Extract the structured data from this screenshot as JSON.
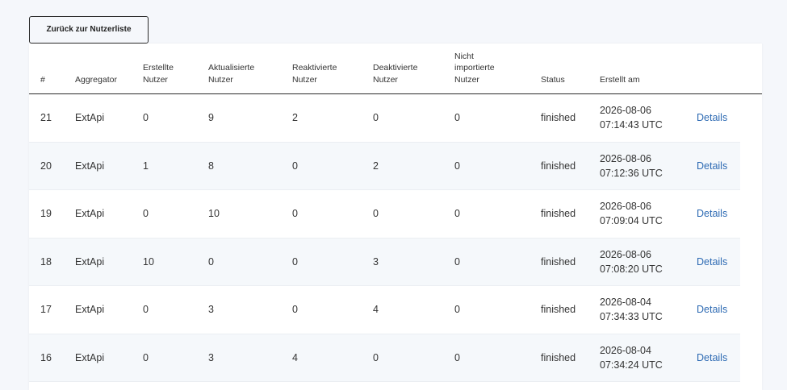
{
  "back_button": {
    "label": "Zurück zur Nutzerliste"
  },
  "table": {
    "headers": [
      "#",
      "Aggregator",
      "Erstellte\nNutzer",
      "Aktualisierte\nNutzer",
      "Reaktivierte\nNutzer",
      "Deaktivierte\nNutzer",
      "Nicht\nimportierte\nNutzer",
      "Status",
      "Erstellt am"
    ],
    "rows": [
      {
        "id": "21",
        "aggregator": "ExtApi",
        "created": "0",
        "updated": "9",
        "reactivated": "2",
        "deactivated": "0",
        "not_imported": "0",
        "status": "finished",
        "created_at": "2026-08-06 07:14:43 UTC",
        "action": "Details"
      },
      {
        "id": "20",
        "aggregator": "ExtApi",
        "created": "1",
        "updated": "8",
        "reactivated": "0",
        "deactivated": "2",
        "not_imported": "0",
        "status": "finished",
        "created_at": "2026-08-06 07:12:36 UTC",
        "action": "Details"
      },
      {
        "id": "19",
        "aggregator": "ExtApi",
        "created": "0",
        "updated": "10",
        "reactivated": "0",
        "deactivated": "0",
        "not_imported": "0",
        "status": "finished",
        "created_at": "2026-08-06 07:09:04 UTC",
        "action": "Details"
      },
      {
        "id": "18",
        "aggregator": "ExtApi",
        "created": "10",
        "updated": "0",
        "reactivated": "0",
        "deactivated": "3",
        "not_imported": "0",
        "status": "finished",
        "created_at": "2026-08-06 07:08:20 UTC",
        "action": "Details"
      },
      {
        "id": "17",
        "aggregator": "ExtApi",
        "created": "0",
        "updated": "3",
        "reactivated": "0",
        "deactivated": "4",
        "not_imported": "0",
        "status": "finished",
        "created_at": "2026-08-04 07:34:33 UTC",
        "action": "Details"
      },
      {
        "id": "16",
        "aggregator": "ExtApi",
        "created": "0",
        "updated": "3",
        "reactivated": "4",
        "deactivated": "0",
        "not_imported": "0",
        "status": "finished",
        "created_at": "2026-08-04 07:34:24 UTC",
        "action": "Details"
      }
    ]
  },
  "colors": {
    "link": "#2d6ab3",
    "page_background": "#f5f7fb",
    "row_alt_background": "#f5f8fb"
  }
}
